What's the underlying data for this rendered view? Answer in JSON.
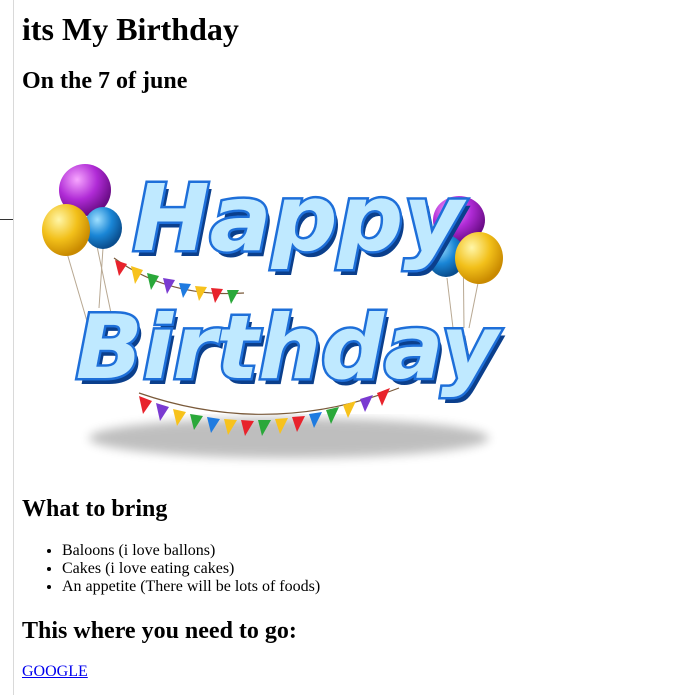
{
  "page": {
    "title": "its My Birthday",
    "subtitle": "On the 7 of june",
    "banner": {
      "line1": "Happy",
      "line2": "Birthday",
      "colors": {
        "text_fill": "#bfe9ff",
        "text_stroke": "#1e6fd9",
        "shadow": "#0b3f8c"
      }
    },
    "bring_heading": "What to bring",
    "bring_items": [
      "Baloons (i love ballons)",
      "Cakes (i love eating cakes)",
      "An appetite (There will be lots of foods)"
    ],
    "directions_heading": "This where you need to go:",
    "link_text": "GOOGLE"
  }
}
